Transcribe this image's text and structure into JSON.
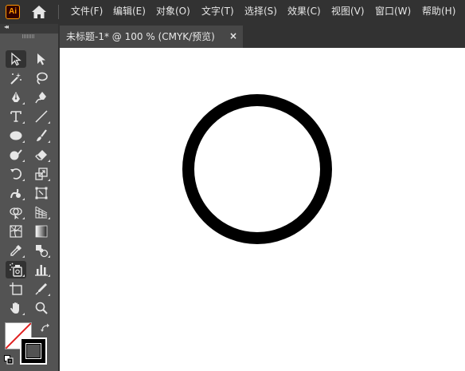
{
  "app": {
    "logo_text": "Ai",
    "logo_color": "#ff9a00",
    "home_icon": "home-icon"
  },
  "menu": {
    "items": [
      {
        "label": "文件(F)"
      },
      {
        "label": "编辑(E)"
      },
      {
        "label": "对象(O)"
      },
      {
        "label": "文字(T)"
      },
      {
        "label": "选择(S)"
      },
      {
        "label": "效果(C)"
      },
      {
        "label": "视图(V)"
      },
      {
        "label": "窗口(W)"
      },
      {
        "label": "帮助(H)"
      }
    ]
  },
  "panel": {
    "collapse_label": "◂◂"
  },
  "document": {
    "tab_title": "未标题-1* @ 100 % (CMYK/预览)",
    "close_label": "×"
  },
  "tools": [
    {
      "icon": "selection-tool-icon",
      "active": false
    },
    {
      "icon": "direct-selection-tool-icon",
      "active": false
    },
    {
      "icon": "magic-wand-tool-icon",
      "active": false
    },
    {
      "icon": "lasso-tool-icon",
      "active": false
    },
    {
      "icon": "pen-tool-icon",
      "active": false
    },
    {
      "icon": "curvature-tool-icon",
      "active": false
    },
    {
      "icon": "type-tool-icon",
      "active": false
    },
    {
      "icon": "line-segment-tool-icon",
      "active": false
    },
    {
      "icon": "ellipse-tool-icon",
      "active": false
    },
    {
      "icon": "paintbrush-tool-icon",
      "active": false
    },
    {
      "icon": "shaper-tool-icon",
      "active": false
    },
    {
      "icon": "eraser-tool-icon",
      "active": false
    },
    {
      "icon": "rotate-tool-icon",
      "active": false
    },
    {
      "icon": "scale-tool-icon",
      "active": false
    },
    {
      "icon": "warp-tool-icon",
      "active": false
    },
    {
      "icon": "free-transform-tool-icon",
      "active": false
    },
    {
      "icon": "shape-builder-tool-icon",
      "active": false
    },
    {
      "icon": "perspective-grid-tool-icon",
      "active": false
    },
    {
      "icon": "mesh-tool-icon",
      "active": false
    },
    {
      "icon": "gradient-tool-icon",
      "active": false
    },
    {
      "icon": "eyedropper-tool-icon",
      "active": false
    },
    {
      "icon": "blend-tool-icon",
      "active": false
    },
    {
      "icon": "symbol-sprayer-tool-icon",
      "active": true
    },
    {
      "icon": "column-graph-tool-icon",
      "active": false
    },
    {
      "icon": "artboard-tool-icon",
      "active": false
    },
    {
      "icon": "slice-tool-icon",
      "active": false
    },
    {
      "icon": "hand-tool-icon",
      "active": false
    },
    {
      "icon": "zoom-tool-icon",
      "active": false
    }
  ],
  "colors": {
    "fill": "none",
    "stroke": "#000000",
    "canvas": "#ffffff",
    "ui_dark": "#323232",
    "ui_panel": "#535353"
  },
  "artwork": {
    "shape": "circle",
    "stroke_color": "#000000",
    "fill_color": "none"
  }
}
